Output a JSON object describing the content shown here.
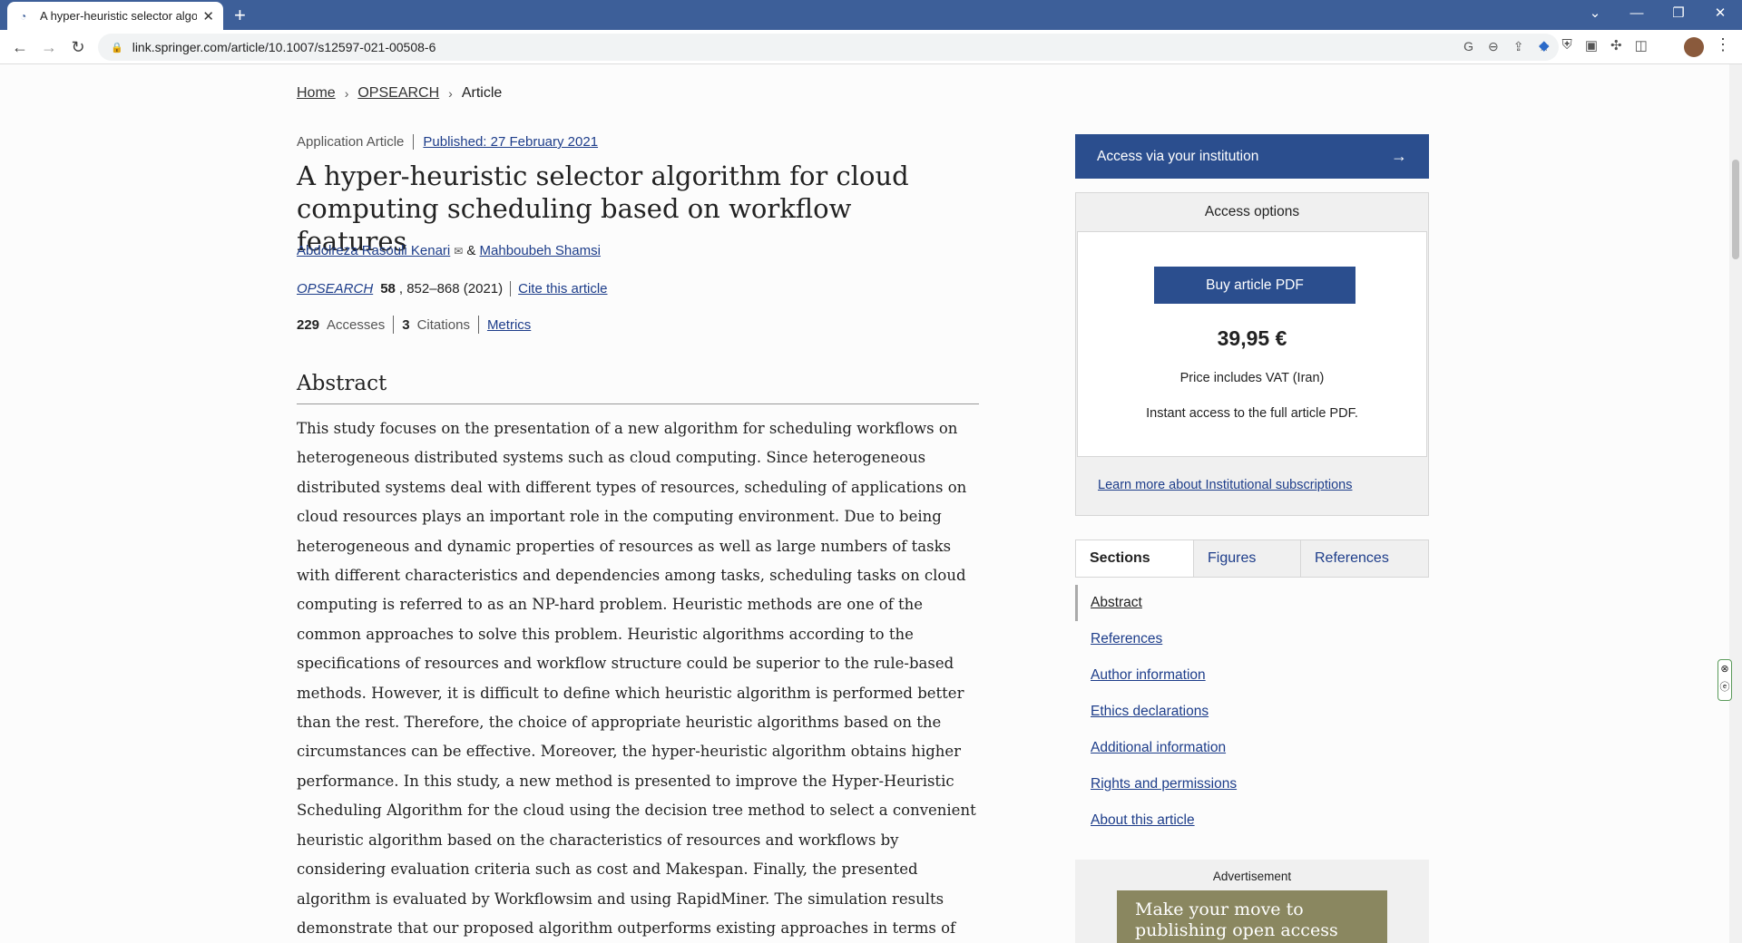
{
  "browser": {
    "tab_title": "A hyper-heuristic selector algorit",
    "url": "link.springer.com/article/10.1007/s12597-021-00508-6"
  },
  "breadcrumb": {
    "home": "Home",
    "journal": "OPSEARCH",
    "current": "Article"
  },
  "article": {
    "type": "Application Article",
    "published": "Published: 27 February 2021",
    "title": "A hyper-heuristic selector algorithm for cloud computing scheduling based on workflow features",
    "author1": "Abdolreza Rasouli Kenari",
    "and": "&",
    "author2": "Mahboubeh Shamsi",
    "journal": "OPSEARCH",
    "volume": "58",
    "pages": ", 852–868 (2021)",
    "cite": "Cite this article",
    "accesses_count": "229",
    "accesses_label": "Accesses",
    "citations_count": "3",
    "citations_label": "Citations",
    "metrics": "Metrics"
  },
  "abstract": {
    "heading": "Abstract",
    "text": "This study focuses on the presentation of a new algorithm for scheduling workflows on heterogeneous distributed systems such as cloud computing. Since heterogeneous distributed systems deal with different types of resources, scheduling of applications on cloud resources plays an important role in the computing environment. Due to being heterogeneous and dynamic properties of resources as well as large numbers of tasks with different characteristics and dependencies among tasks, scheduling tasks on cloud computing is referred to as an NP-hard problem. Heuristic methods are one of the common approaches to solve this problem. Heuristic algorithms according to the specifications of resources and workflow structure could be superior to the rule-based methods. However, it is difficult to define which heuristic algorithm is performed better than the rest. Therefore, the choice of appropriate heuristic algorithms based on the circumstances can be effective. Moreover, the hyper-heuristic algorithm obtains higher performance. In this study, a new method is presented to improve the Hyper-Heuristic Scheduling Algorithm for the cloud using the decision tree method to select a convenient heuristic algorithm based on the characteristics of resources and workflows by considering evaluation criteria such as cost and Makespan. Finally, the presented algorithm is evaluated by Workflowsim and using RapidMiner. The simulation results demonstrate that our proposed algorithm outperforms existing approaches in terms of Makespan and Accuracy."
  },
  "sidebar": {
    "access_button": "Access via your institution",
    "options_heading": "Access options",
    "buy_button": "Buy article PDF",
    "price": "39,95 €",
    "vat": "Price includes VAT (Iran)",
    "instant": "Instant access to the full article PDF.",
    "learn_more": "Learn more about Institutional subscriptions",
    "tabs": [
      "Sections",
      "Figures",
      "References"
    ],
    "sections": [
      "Abstract",
      "References",
      "Author information",
      "Ethics declarations",
      "Additional information",
      "Rights and permissions",
      "About this article"
    ],
    "ad_label": "Advertisement",
    "ad_text": "Make your move to publishing open access today."
  },
  "colors": {
    "chrome": "#3d5f99",
    "brand_button": "#2b4e8e",
    "link": "#1d3d8a"
  }
}
